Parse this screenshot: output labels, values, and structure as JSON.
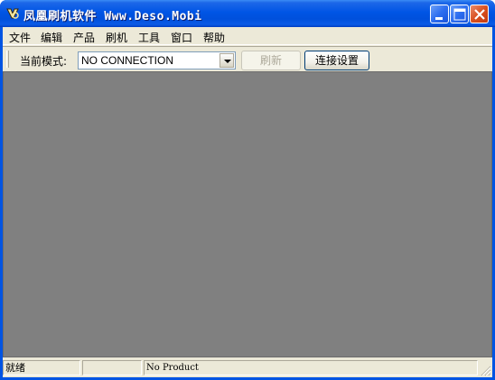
{
  "window": {
    "title": "凤凰刷机软件 Www.Deso.Mobi",
    "icon": "phoenix-app-icon",
    "controls": [
      "minimize-icon",
      "maximize-icon",
      "close-icon"
    ]
  },
  "menubar": {
    "items": [
      {
        "label": "文件"
      },
      {
        "label": "编辑"
      },
      {
        "label": "产品"
      },
      {
        "label": "刷机"
      },
      {
        "label": "工具"
      },
      {
        "label": "窗口"
      },
      {
        "label": "帮助"
      }
    ]
  },
  "toolbar": {
    "mode_label": "当前模式:",
    "mode_value": "NO CONNECTION",
    "refresh_label": "刷新",
    "refresh_enabled": false,
    "connect_settings_label": "连接设置"
  },
  "statusbar": {
    "ready_text": "就绪",
    "pane2_text": "",
    "product_text": "No Product"
  },
  "colors": {
    "titlebar": "#0054e3",
    "workspace": "#808080",
    "frame": "#ece9d8",
    "close_button": "#d9501f"
  }
}
